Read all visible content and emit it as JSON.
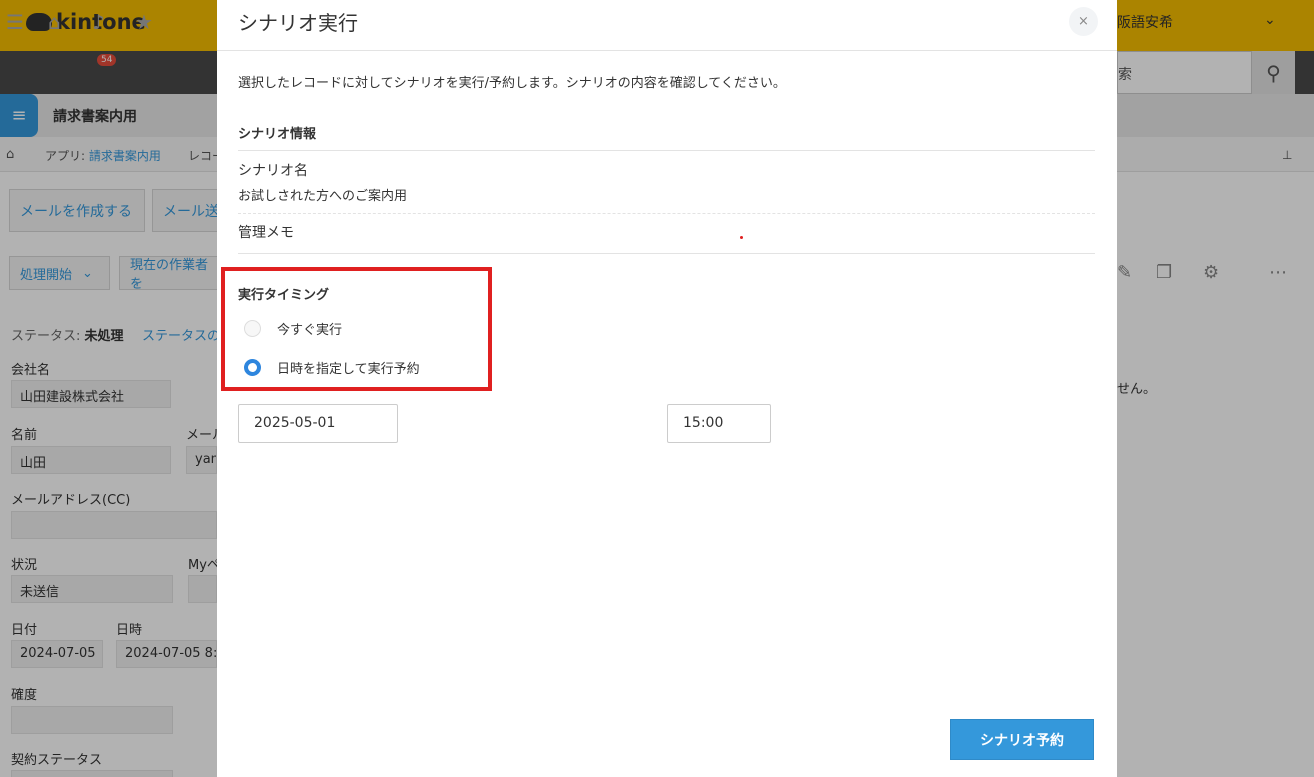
{
  "app": {
    "logo_text": "kintone",
    "user_name": "阪語安希",
    "notification_count": "54",
    "search_placeholder": "索",
    "app_name": "請求書案内用"
  },
  "breadcrumb": {
    "app_prefix": "アプリ: ",
    "app_name": "請求書案内用",
    "record": "レコー"
  },
  "toolbar": {
    "create_mail": "メールを作成する",
    "mail_send": "メール送",
    "process_start": "処理開始",
    "current_worker": "現在の作業者を"
  },
  "record": {
    "status_label": "ステータス: ",
    "status_value": "未処理",
    "status_link": "ステータスの",
    "side_text": "せん。",
    "fields": [
      {
        "label": "会社名",
        "value": "山田建設株式会社"
      },
      {
        "label": "名前",
        "value": "山田"
      },
      {
        "label": "メール",
        "value": "yam"
      },
      {
        "label": "メールアドレス(CC)",
        "value": ""
      },
      {
        "label": "状況",
        "value": "未送信"
      },
      {
        "label": "Myペ",
        "value": ""
      },
      {
        "label": "日付",
        "value": "2024-07-05"
      },
      {
        "label": "日時",
        "value": "2024-07-05 8:"
      },
      {
        "label": "確度",
        "value": ""
      },
      {
        "label": "契約ステータス",
        "value": ""
      }
    ]
  },
  "modal": {
    "title": "シナリオ実行",
    "close_label": "×",
    "description": "選択したレコードに対してシナリオを実行/予約します。シナリオの内容を確認してください。",
    "info_section": "シナリオ情報",
    "scenario_name_label": "シナリオ名",
    "scenario_name_value": "お試しされた方へのご案内用",
    "memo_label": "管理メモ",
    "timing_section": "実行タイミング",
    "option_now": "今すぐ実行",
    "option_schedule": "日時を指定して実行予約",
    "selected_option": "schedule",
    "date_value": "2025-05-01",
    "time_value": "15:00",
    "submit_label": "シナリオ予約"
  },
  "colors": {
    "brand_yellow": "#f5bd00",
    "accent_blue": "#3498db",
    "highlight_red": "#e02020"
  }
}
